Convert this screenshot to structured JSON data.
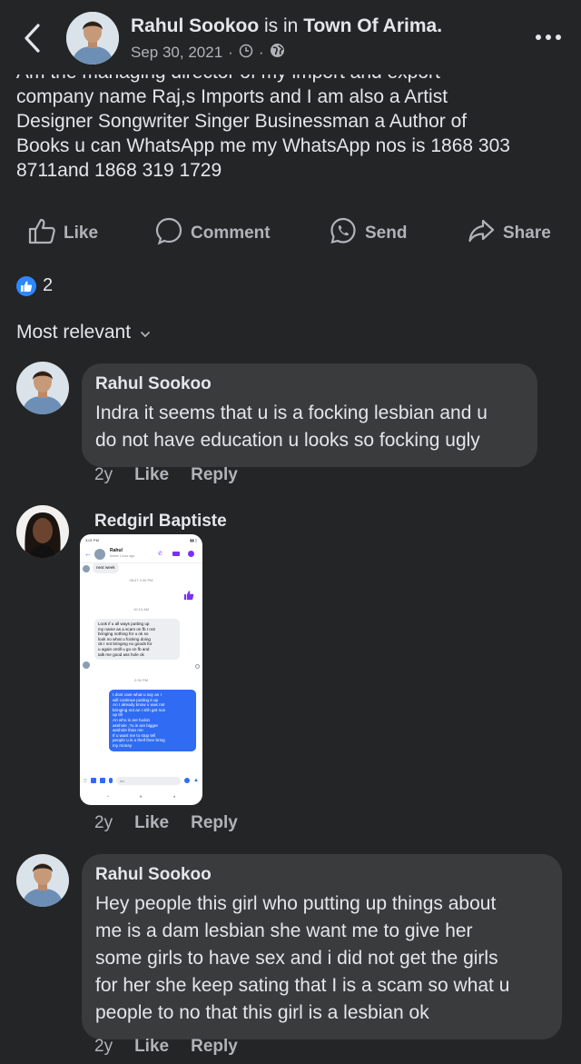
{
  "header": {
    "author": "Rahul Sookoo",
    "connector": " is in ",
    "place": "Town Of Arima.",
    "date": "Sep 30, 2021",
    "sep1": "·",
    "sep2": "·"
  },
  "post": {
    "lines": [
      "Am the managing director of my import and export",
      "company name Raj,s Imports and I am also a Artist",
      "Designer Songwriter Singer Businessman a Author of",
      "Books u can WhatsApp me my WhatsApp nos is 1868 303",
      "8711and 1868 319 1729"
    ]
  },
  "actions": {
    "like": "Like",
    "comment": "Comment",
    "send": "Send",
    "share": "Share"
  },
  "reactions": {
    "count": "2"
  },
  "sort": {
    "label": "Most relevant"
  },
  "comments": [
    {
      "name": "Rahul Sookoo",
      "lines": [
        "Indra it seems that u is a focking lesbian and u",
        "do not have education u looks so focking ugly"
      ],
      "age": "2y",
      "like": "Like",
      "reply": "Reply"
    },
    {
      "name": "Redgirl Baptiste",
      "age": "2y",
      "like": "Like",
      "reply": "Reply",
      "screenshot": {
        "status_time": "3:01 PM",
        "contact": "Rahul",
        "contact_sub": "Active 1 hour ago",
        "first_msg": "next week",
        "time1": "08:47 2:40 PM",
        "time2": "10:10 AM",
        "recv_lines": [
          "Look if u all ways putting up",
          "my name as a scam on fb I not",
          "bringing nothing for u ok so",
          "look no what u focking doing",
          "ok I not bringing no goods for",
          "u again ontill u go on fb and",
          "talk me good ass hole ok"
        ],
        "time3": "2:30 PM",
        "sent_lines": [
          "I dont care what u say an I",
          "will continue putting it up",
          "An I already know u was not",
          "bringing not an I shh get nun",
          "up till",
          "An who is are fuckin",
          "asshole ,?u is are bigger",
          "asshole than me",
          "If u want me to stop tell",
          "people u is a theif then bring",
          "my money"
        ],
        "input_placeholder": "Aa"
      }
    },
    {
      "name": "Rahul Sookoo",
      "lines": [
        "Hey people this girl who putting up things about",
        "me is a dam lesbian she want me to give her",
        "some girls to have sex and i did not get the girls",
        "for her she keep sating that I is a scam so what u",
        "people to no that this girl is a lesbian ok"
      ],
      "age": "2y",
      "like": "Like",
      "reply": "Reply"
    }
  ],
  "colors": {
    "background": "#242526",
    "bubble": "#3a3b3c",
    "text": "#e4e6eb",
    "muted": "#b0b3b8",
    "accent": "#2d88ff",
    "messenger_purple": "#7b2ff7"
  },
  "icons": [
    "back-chevron-icon",
    "clock-icon",
    "globe-icon",
    "more-dots-icon",
    "thumbs-up-icon",
    "comment-icon",
    "whatsapp-send-icon",
    "share-arrow-icon",
    "like-reaction-icon",
    "chevron-down-icon"
  ]
}
